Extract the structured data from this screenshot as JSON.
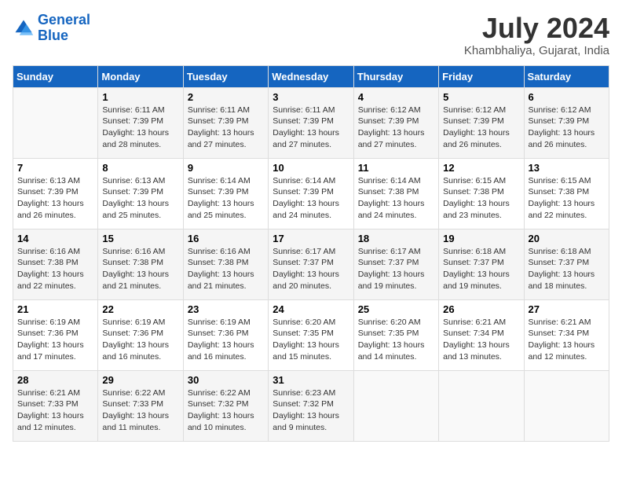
{
  "header": {
    "logo_line1": "General",
    "logo_line2": "Blue",
    "month_title": "July 2024",
    "location": "Khambhaliya, Gujarat, India"
  },
  "days_of_week": [
    "Sunday",
    "Monday",
    "Tuesday",
    "Wednesday",
    "Thursday",
    "Friday",
    "Saturday"
  ],
  "weeks": [
    [
      {
        "num": "",
        "info": ""
      },
      {
        "num": "1",
        "info": "Sunrise: 6:11 AM\nSunset: 7:39 PM\nDaylight: 13 hours\nand 28 minutes."
      },
      {
        "num": "2",
        "info": "Sunrise: 6:11 AM\nSunset: 7:39 PM\nDaylight: 13 hours\nand 27 minutes."
      },
      {
        "num": "3",
        "info": "Sunrise: 6:11 AM\nSunset: 7:39 PM\nDaylight: 13 hours\nand 27 minutes."
      },
      {
        "num": "4",
        "info": "Sunrise: 6:12 AM\nSunset: 7:39 PM\nDaylight: 13 hours\nand 27 minutes."
      },
      {
        "num": "5",
        "info": "Sunrise: 6:12 AM\nSunset: 7:39 PM\nDaylight: 13 hours\nand 26 minutes."
      },
      {
        "num": "6",
        "info": "Sunrise: 6:12 AM\nSunset: 7:39 PM\nDaylight: 13 hours\nand 26 minutes."
      }
    ],
    [
      {
        "num": "7",
        "info": "Sunrise: 6:13 AM\nSunset: 7:39 PM\nDaylight: 13 hours\nand 26 minutes."
      },
      {
        "num": "8",
        "info": "Sunrise: 6:13 AM\nSunset: 7:39 PM\nDaylight: 13 hours\nand 25 minutes."
      },
      {
        "num": "9",
        "info": "Sunrise: 6:14 AM\nSunset: 7:39 PM\nDaylight: 13 hours\nand 25 minutes."
      },
      {
        "num": "10",
        "info": "Sunrise: 6:14 AM\nSunset: 7:39 PM\nDaylight: 13 hours\nand 24 minutes."
      },
      {
        "num": "11",
        "info": "Sunrise: 6:14 AM\nSunset: 7:38 PM\nDaylight: 13 hours\nand 24 minutes."
      },
      {
        "num": "12",
        "info": "Sunrise: 6:15 AM\nSunset: 7:38 PM\nDaylight: 13 hours\nand 23 minutes."
      },
      {
        "num": "13",
        "info": "Sunrise: 6:15 AM\nSunset: 7:38 PM\nDaylight: 13 hours\nand 22 minutes."
      }
    ],
    [
      {
        "num": "14",
        "info": "Sunrise: 6:16 AM\nSunset: 7:38 PM\nDaylight: 13 hours\nand 22 minutes."
      },
      {
        "num": "15",
        "info": "Sunrise: 6:16 AM\nSunset: 7:38 PM\nDaylight: 13 hours\nand 21 minutes."
      },
      {
        "num": "16",
        "info": "Sunrise: 6:16 AM\nSunset: 7:38 PM\nDaylight: 13 hours\nand 21 minutes."
      },
      {
        "num": "17",
        "info": "Sunrise: 6:17 AM\nSunset: 7:37 PM\nDaylight: 13 hours\nand 20 minutes."
      },
      {
        "num": "18",
        "info": "Sunrise: 6:17 AM\nSunset: 7:37 PM\nDaylight: 13 hours\nand 19 minutes."
      },
      {
        "num": "19",
        "info": "Sunrise: 6:18 AM\nSunset: 7:37 PM\nDaylight: 13 hours\nand 19 minutes."
      },
      {
        "num": "20",
        "info": "Sunrise: 6:18 AM\nSunset: 7:37 PM\nDaylight: 13 hours\nand 18 minutes."
      }
    ],
    [
      {
        "num": "21",
        "info": "Sunrise: 6:19 AM\nSunset: 7:36 PM\nDaylight: 13 hours\nand 17 minutes."
      },
      {
        "num": "22",
        "info": "Sunrise: 6:19 AM\nSunset: 7:36 PM\nDaylight: 13 hours\nand 16 minutes."
      },
      {
        "num": "23",
        "info": "Sunrise: 6:19 AM\nSunset: 7:36 PM\nDaylight: 13 hours\nand 16 minutes."
      },
      {
        "num": "24",
        "info": "Sunrise: 6:20 AM\nSunset: 7:35 PM\nDaylight: 13 hours\nand 15 minutes."
      },
      {
        "num": "25",
        "info": "Sunrise: 6:20 AM\nSunset: 7:35 PM\nDaylight: 13 hours\nand 14 minutes."
      },
      {
        "num": "26",
        "info": "Sunrise: 6:21 AM\nSunset: 7:34 PM\nDaylight: 13 hours\nand 13 minutes."
      },
      {
        "num": "27",
        "info": "Sunrise: 6:21 AM\nSunset: 7:34 PM\nDaylight: 13 hours\nand 12 minutes."
      }
    ],
    [
      {
        "num": "28",
        "info": "Sunrise: 6:21 AM\nSunset: 7:33 PM\nDaylight: 13 hours\nand 12 minutes."
      },
      {
        "num": "29",
        "info": "Sunrise: 6:22 AM\nSunset: 7:33 PM\nDaylight: 13 hours\nand 11 minutes."
      },
      {
        "num": "30",
        "info": "Sunrise: 6:22 AM\nSunset: 7:32 PM\nDaylight: 13 hours\nand 10 minutes."
      },
      {
        "num": "31",
        "info": "Sunrise: 6:23 AM\nSunset: 7:32 PM\nDaylight: 13 hours\nand 9 minutes."
      },
      {
        "num": "",
        "info": ""
      },
      {
        "num": "",
        "info": ""
      },
      {
        "num": "",
        "info": ""
      }
    ]
  ]
}
